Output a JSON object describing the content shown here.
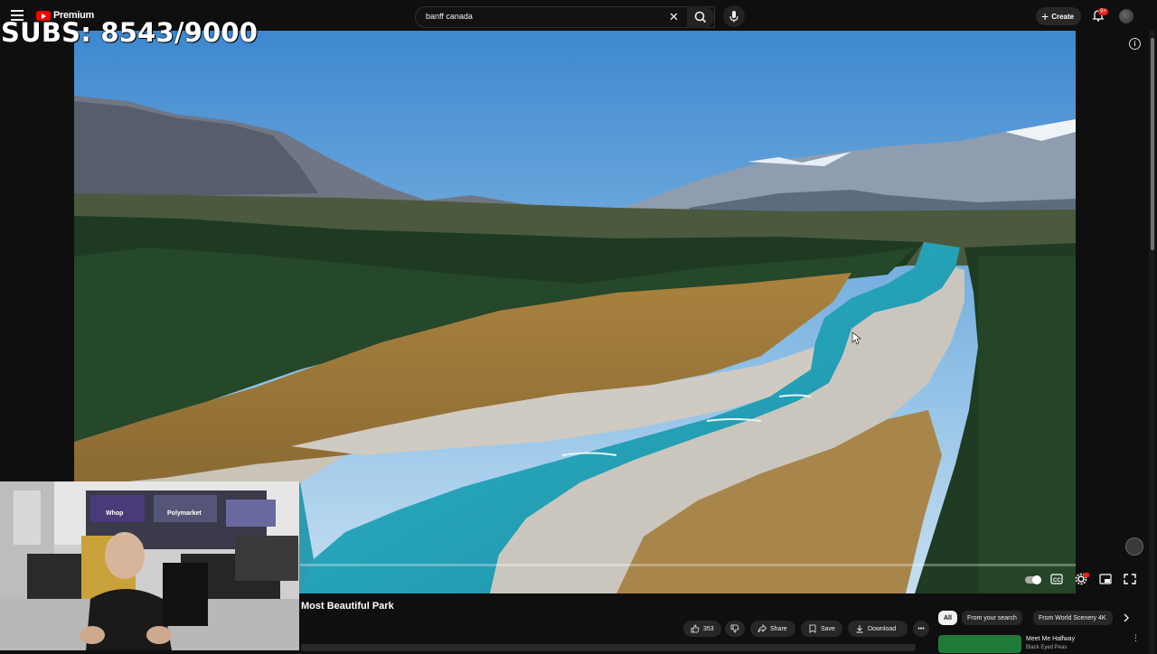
{
  "header": {
    "logo_text": "Premium",
    "search_value": "banff canada",
    "create_label": "Create",
    "notification_count": "9+"
  },
  "overlay": {
    "subs_text": "SUBS: 8543/9000"
  },
  "video": {
    "title": "Most Beautiful Park",
    "actions": {
      "like_count": "353",
      "share_label": "Share",
      "save_label": "Save",
      "download_label": "Download"
    }
  },
  "sidebar": {
    "chips": [
      "All",
      "From your search",
      "From World Scenery 4K"
    ],
    "recommendation": {
      "title": "Meet Me Halfway",
      "channel": "Black Eyed Peas"
    }
  },
  "webcam": {
    "sign_whop": "Whop",
    "sign_polymarket": "Polymarket"
  },
  "colors": {
    "background": "#0f0f0f",
    "brand_red": "#ff0000",
    "button_bg": "#272727"
  },
  "icons": [
    "menu-icon",
    "youtube-logo-icon",
    "search-icon",
    "close-icon",
    "mic-icon",
    "plus-icon",
    "bell-icon",
    "info-icon",
    "like-icon",
    "dislike-icon",
    "share-icon",
    "save-icon",
    "download-icon",
    "more-icon",
    "chevron-right-icon",
    "autoplay-toggle-icon",
    "captions-icon",
    "settings-icon",
    "miniplayer-icon",
    "fullscreen-icon"
  ]
}
